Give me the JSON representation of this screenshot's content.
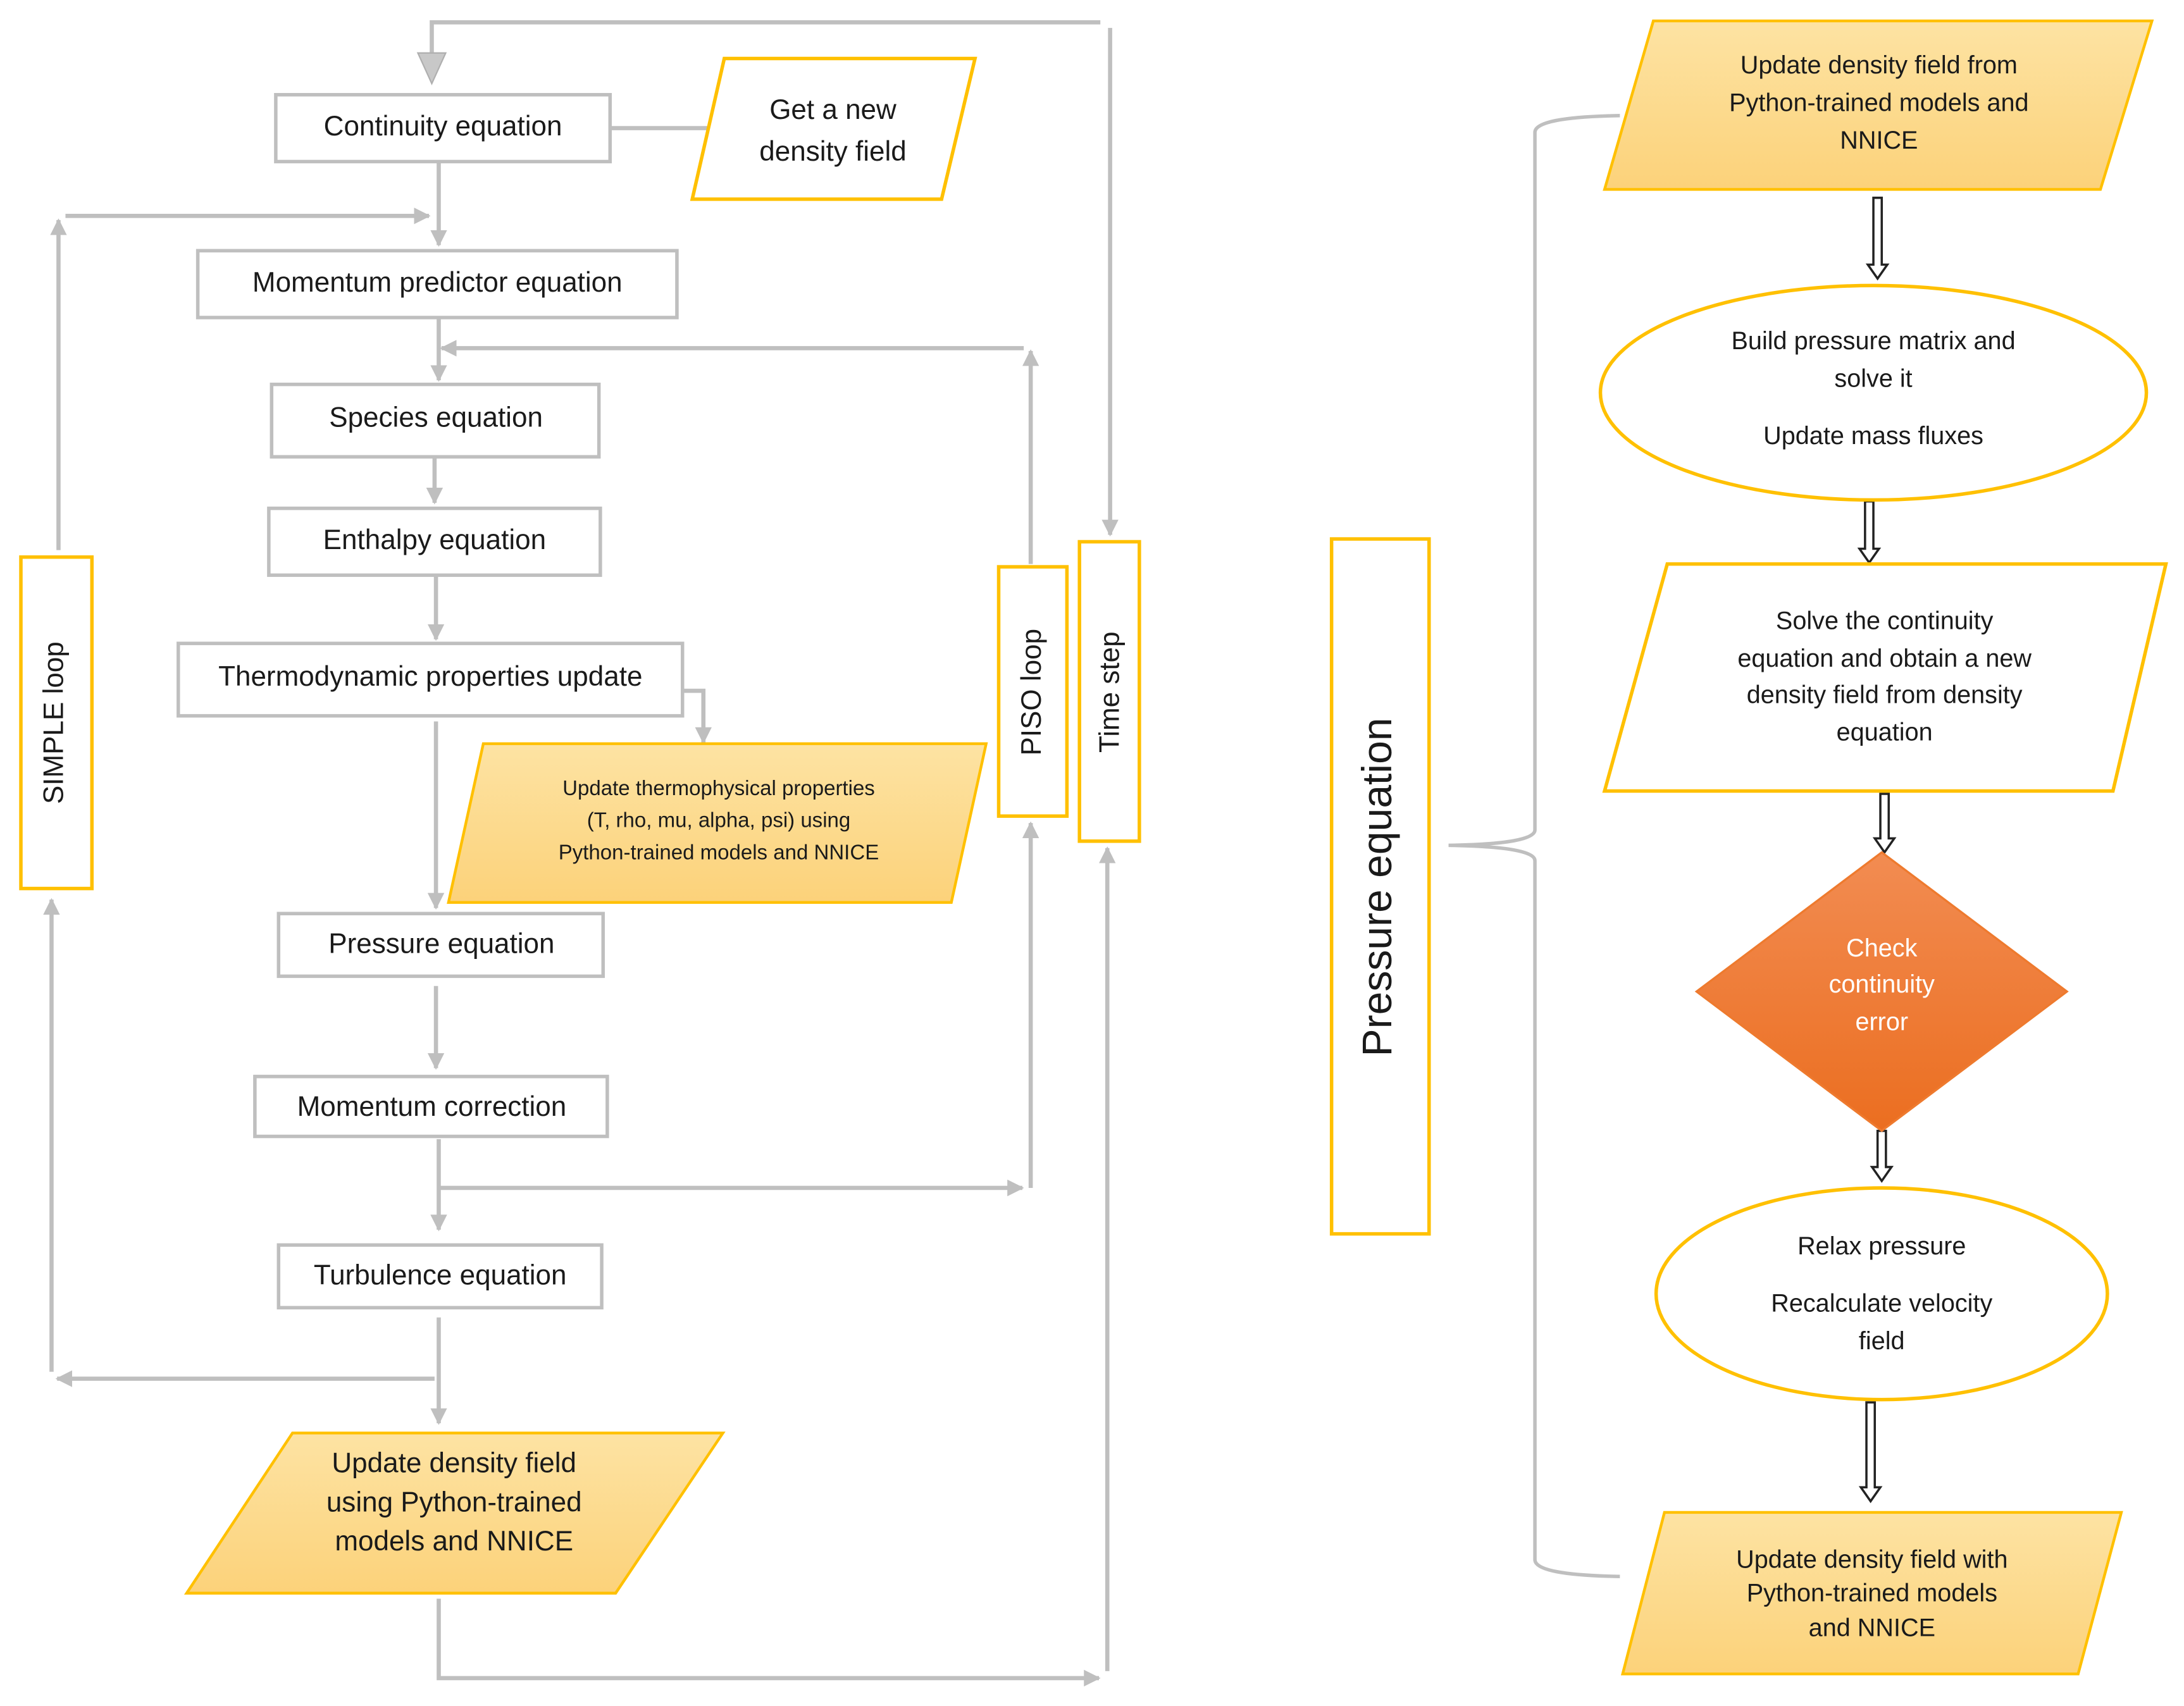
{
  "colors": {
    "box_border": "#BFBFBF",
    "accent_border": "#FFC000",
    "highlight_fill_top": "#FDE3A3",
    "highlight_fill_bottom": "#FCD27A",
    "decision_top": "#F28C52",
    "decision_bottom": "#EB6E20",
    "connector": "#BFBFBF"
  },
  "left": {
    "continuity": "Continuity equation",
    "new_density": [
      "Get a new",
      "density field"
    ],
    "momentum_predictor": "Momentum predictor equation",
    "species": "Species equation",
    "enthalpy": "Enthalpy equation",
    "thermo": "Thermodynamic properties update",
    "thermophysical": [
      "Update thermophysical properties",
      "(T, rho, mu, alpha, psi) using",
      "Python-trained models and NNICE"
    ],
    "pressure": "Pressure equation",
    "momentum_correction": "Momentum correction",
    "turbulence": "Turbulence equation",
    "update_density": [
      "Update density field",
      "using Python-trained",
      "models and NNICE"
    ],
    "simple_loop": "SIMPLE loop",
    "piso_loop": "PISO loop",
    "time_step": "Time step"
  },
  "right": {
    "pressure_equation": "Pressure equation",
    "update_density_top": [
      "Update density field from",
      "Python-trained models and",
      "NNICE"
    ],
    "build_pressure": [
      "Build pressure matrix and",
      "solve it",
      "Update mass fluxes"
    ],
    "solve_continuity": [
      "Solve the continuity",
      "equation and obtain a new",
      "density field from density",
      "equation"
    ],
    "check": [
      "Check",
      "continuity",
      "error"
    ],
    "relax": [
      "Relax pressure",
      "Recalculate velocity",
      "field"
    ],
    "update_density_bottom": [
      "Update density field with",
      "Python-trained models",
      "and NNICE"
    ]
  }
}
